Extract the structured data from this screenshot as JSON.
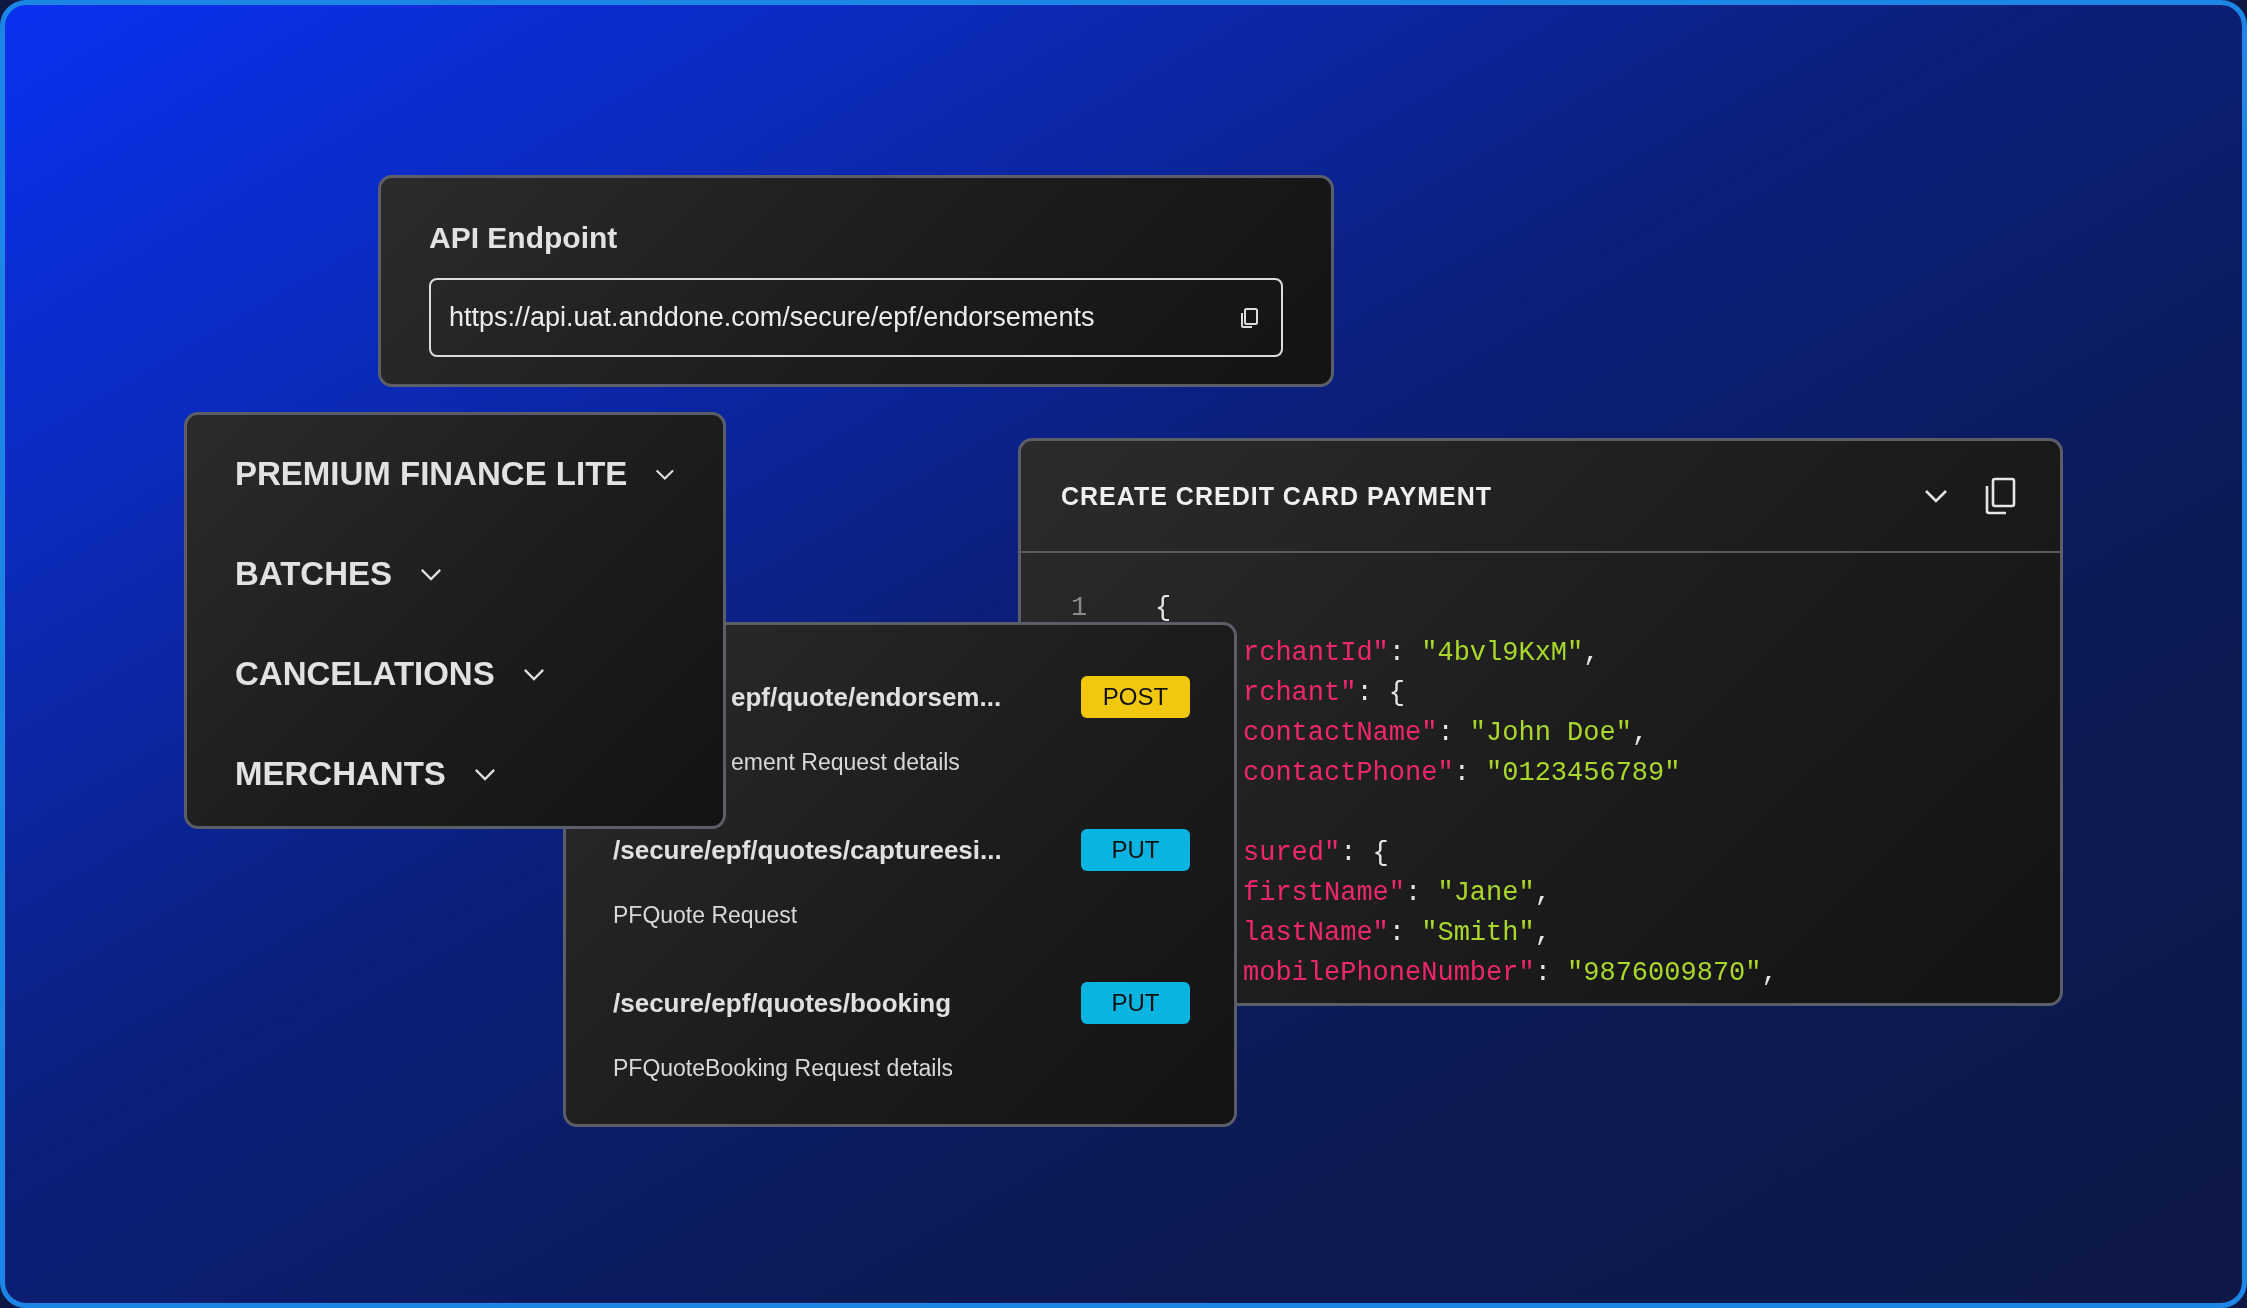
{
  "api_endpoint": {
    "title": "API Endpoint",
    "url": "https://api.uat.anddone.com/secure/epf/endorsements"
  },
  "menu": {
    "items": [
      {
        "label": "PREMIUM FINANCE LITE"
      },
      {
        "label": "BATCHES"
      },
      {
        "label": "CANCELATIONS"
      },
      {
        "label": "MERCHANTS"
      }
    ]
  },
  "endpoints": [
    {
      "path": "epf/quote/endorsem...",
      "method": "POST",
      "color": "#f2c80f",
      "description": "ement Request details"
    },
    {
      "path": "/secure/epf/quotes/captureesi...",
      "method": "PUT",
      "color": "#0ab4e0",
      "description": "PFQuote Request"
    },
    {
      "path": "/secure/epf/quotes/booking",
      "method": "PUT",
      "color": "#0ab4e0",
      "description": "PFQuoteBooking Request details"
    }
  ],
  "code_panel": {
    "title": "CREATE CREDIT CARD PAYMENT",
    "line_number": "1",
    "opening": "{",
    "blocks": [
      [
        [
          {
            "kind": "key",
            "text": "rchantId\""
          },
          {
            "kind": "punct",
            "text": ": "
          },
          {
            "kind": "string",
            "text": "\"4bvl9KxM\""
          },
          {
            "kind": "punct",
            "text": ","
          }
        ],
        [
          {
            "kind": "key",
            "text": "rchant\""
          },
          {
            "kind": "punct",
            "text": ": {"
          }
        ],
        [
          {
            "kind": "key",
            "text": "contactName\""
          },
          {
            "kind": "punct",
            "text": ": "
          },
          {
            "kind": "string",
            "text": "\"John Doe\""
          },
          {
            "kind": "punct",
            "text": ","
          }
        ],
        [
          {
            "kind": "key",
            "text": "contactPhone\""
          },
          {
            "kind": "punct",
            "text": ": "
          },
          {
            "kind": "string",
            "text": "\"0123456789\""
          }
        ]
      ],
      [
        [
          {
            "kind": "key",
            "text": "sured\""
          },
          {
            "kind": "punct",
            "text": ": {"
          }
        ],
        [
          {
            "kind": "key",
            "text": "firstName\""
          },
          {
            "kind": "punct",
            "text": ": "
          },
          {
            "kind": "string",
            "text": "\"Jane\""
          },
          {
            "kind": "punct",
            "text": ","
          }
        ],
        [
          {
            "kind": "key",
            "text": "lastName\""
          },
          {
            "kind": "punct",
            "text": ": "
          },
          {
            "kind": "string",
            "text": "\"Smith\""
          },
          {
            "kind": "punct",
            "text": ","
          }
        ],
        [
          {
            "kind": "key",
            "text": "mobilePhoneNumber\""
          },
          {
            "kind": "punct",
            "text": ": "
          },
          {
            "kind": "string",
            "text": "\"9876009870\""
          },
          {
            "kind": "punct",
            "text": ","
          }
        ]
      ]
    ]
  }
}
